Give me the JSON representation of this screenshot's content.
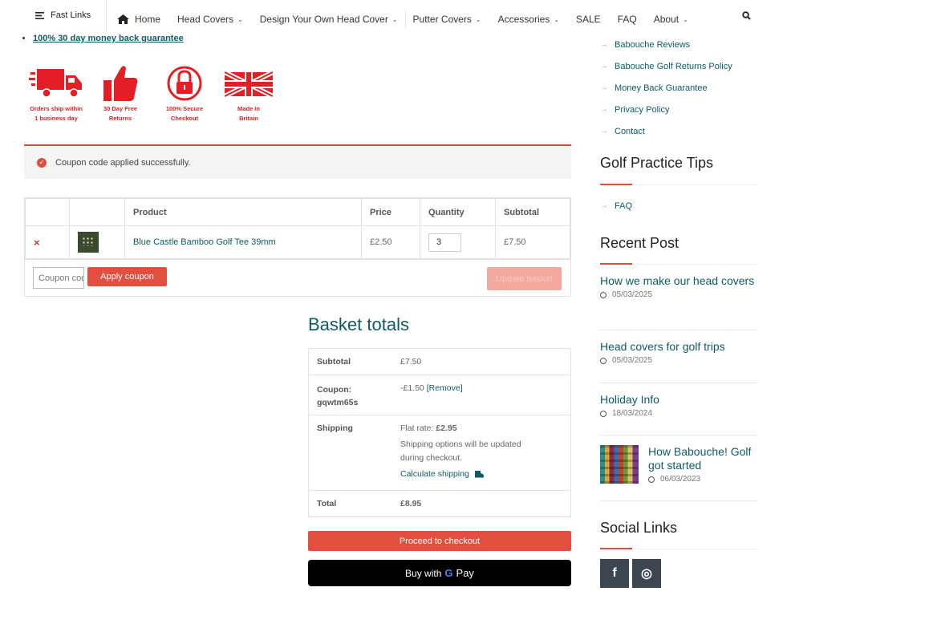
{
  "nav": {
    "fast_links": "Fast Links",
    "home": "Home",
    "items": [
      {
        "label": "Head Covers",
        "chevron": true
      },
      {
        "label": "Design Your Own Head Cover",
        "chevron": true
      },
      {
        "label": "Putter Covers",
        "chevron": true
      },
      {
        "label": "Accessories",
        "chevron": true
      },
      {
        "label": "SALE",
        "chevron": false
      },
      {
        "label": "FAQ",
        "chevron": false
      },
      {
        "label": "About",
        "chevron": true
      }
    ]
  },
  "guarantee": "100% 30 day money back guarantee",
  "badges": [
    {
      "icon": "truck-icon",
      "line1": "Orders ship within",
      "line2": "1 business day"
    },
    {
      "icon": "thumbs-up-icon",
      "line1": "30 Day Free",
      "line2": "Returns"
    },
    {
      "icon": "lock-icon",
      "line1": "100% Secure",
      "line2": "Checkout"
    },
    {
      "icon": "union-flag-icon",
      "line1": "Made In",
      "line2": "Britain"
    }
  ],
  "notice": "Coupon code applied successfully.",
  "cart": {
    "headers": {
      "product": "Product",
      "price": "Price",
      "quantity": "Quantity",
      "subtotal": "Subtotal"
    },
    "row": {
      "remove": "×",
      "product": "Blue Castle Bamboo Golf Tee 39mm",
      "price": "£2.50",
      "quantity": "3",
      "subtotal": "£7.50"
    },
    "coupon_placeholder": "Coupon code",
    "apply_label": "Apply coupon",
    "update_label": "Update basket"
  },
  "totals": {
    "title": "Basket totals",
    "subtotal_label": "Subtotal",
    "subtotal_value": "£7.50",
    "coupon_label": "Coupon:",
    "coupon_code": "gqwtm65s",
    "coupon_value": "-£1.50",
    "coupon_remove": "[Remove]",
    "shipping_label": "Shipping",
    "shipping_rate_prefix": "Flat rate:",
    "shipping_rate": "£2.95",
    "shipping_note": "Shipping options will be updated during checkout.",
    "calc_shipping": "Calculate shipping",
    "total_label": "Total",
    "total_value": "£8.95",
    "checkout_label": "Proceed to checkout",
    "gpay_prefix": "Buy with",
    "gpay_g": "G",
    "gpay_pay": "Pay"
  },
  "sidebar": {
    "links": [
      "Babouche Reviews",
      "Babouche Golf Returns Policy",
      "Money Back Guarantee",
      "Privacy Policy",
      "Contact"
    ],
    "tips_title": "Golf Practice Tips",
    "tips_links": [
      "FAQ"
    ],
    "recent_title": "Recent Post",
    "posts": [
      {
        "title": "How we make our head covers",
        "date": "05/03/2025"
      },
      {
        "title": "Head covers for golf trips",
        "date": "05/03/2025"
      },
      {
        "title": "Holiday Info",
        "date": "18/03/2024"
      },
      {
        "title": "How Babouche! Golf got started",
        "date": "06/03/2023"
      }
    ],
    "social_title": "Social Links",
    "social": [
      {
        "icon": "facebook-icon",
        "glyph": "f"
      },
      {
        "icon": "instagram-icon",
        "glyph": "◎"
      }
    ]
  },
  "colors": {
    "accent": "#e34f3f",
    "teal": "#0d5b66",
    "badge_red": "#e31e24"
  }
}
